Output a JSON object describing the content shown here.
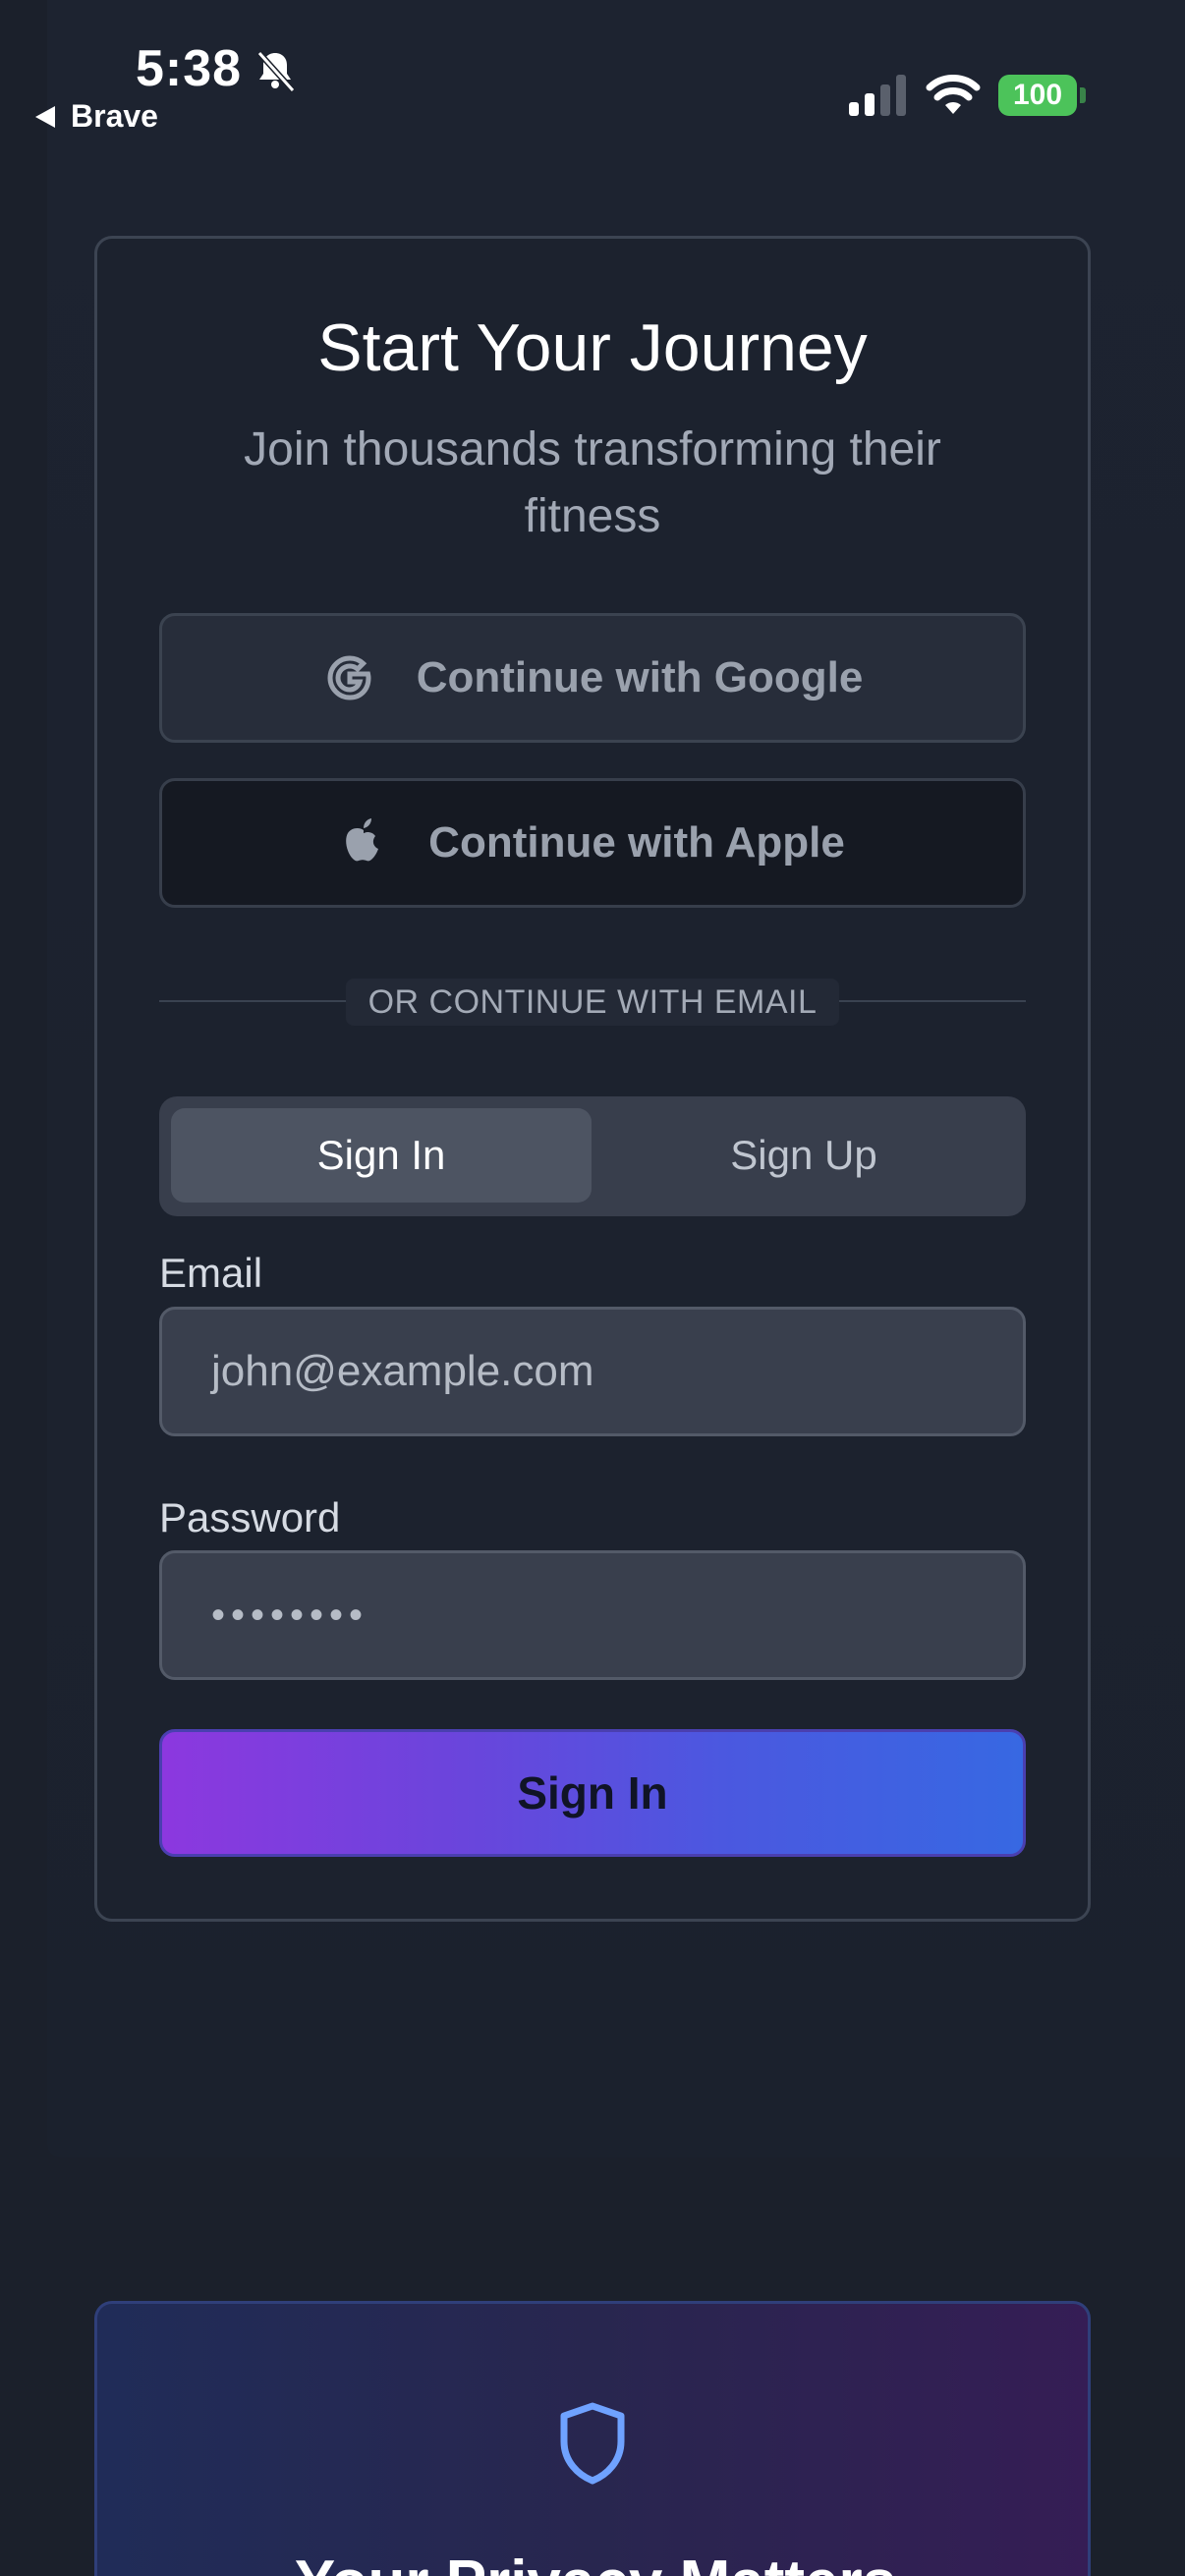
{
  "status_bar": {
    "time": "5:38",
    "back_app": "Brave",
    "battery": "100"
  },
  "auth": {
    "title": "Start Your Journey",
    "subtitle": "Join thousands transforming their fitness",
    "google_label": "Continue with Google",
    "apple_label": "Continue with Apple",
    "divider": "OR CONTINUE WITH EMAIL",
    "tabs": [
      {
        "label": "Sign In",
        "active": true
      },
      {
        "label": "Sign Up",
        "active": false
      }
    ],
    "email_label": "Email",
    "email_placeholder": "john@example.com",
    "password_label": "Password",
    "password_value": "••••••••",
    "submit_label": "Sign In"
  },
  "privacy": {
    "title": "Your Privacy Matters"
  },
  "colors": {
    "background": "#1b202b",
    "card_border": "#3c4452",
    "accent_start": "#8c38df",
    "accent_end": "#3768e2",
    "battery": "#4cc35a",
    "shield": "#6fa2ff"
  },
  "icons": [
    "bell-slash-icon",
    "back-triangle-icon",
    "cellular-signal-icon",
    "wifi-icon",
    "google-icon",
    "apple-icon",
    "shield-icon"
  ]
}
